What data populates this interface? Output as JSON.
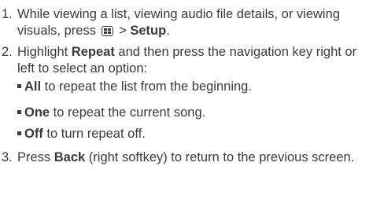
{
  "steps": [
    {
      "number": "1.",
      "text_before": "While viewing a list, viewing audio file details, or viewing visuals, press ",
      "separator": " > ",
      "bold": "Setup",
      "text_after": "."
    },
    {
      "number": "2.",
      "text_before": "Highlight ",
      "bold": "Repeat",
      "text_after": " and then press the navigation key right or left to select an option:"
    },
    {
      "number": "3.",
      "text_before": "Press ",
      "bold": "Back",
      "text_after": " (right softkey) to return to the previous screen."
    }
  ],
  "options": [
    {
      "bold": "All",
      "text": " to repeat the list from the beginning."
    },
    {
      "bold": "One",
      "text": " to repeat the current song."
    },
    {
      "bold": "Off",
      "text": " to turn repeat off."
    }
  ],
  "icons": {
    "menu_key": "menu-key-icon",
    "bullet": "square-bullet-icon"
  }
}
